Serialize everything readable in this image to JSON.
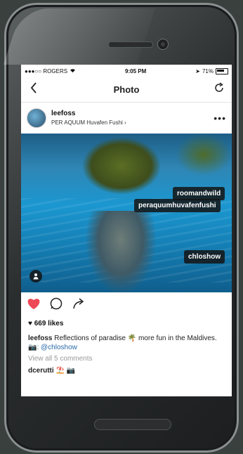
{
  "status_bar": {
    "carrier": "●●●○○ ROGERS",
    "time": "9:05 PM",
    "battery": "71%"
  },
  "nav": {
    "title": "Photo",
    "back_icon": "back-chevron-icon",
    "refresh_icon": "refresh-icon"
  },
  "post": {
    "username": "leefoss",
    "location": "PER AQUUM Huvafen Fushi",
    "more_label": "•••",
    "tags": [
      "roomandwild",
      "peraquumhuvafenfushi",
      "chloshow"
    ],
    "likes": "♥ 669 likes",
    "caption_user": "leefoss",
    "caption_text": "Reflections of paradise 🌴 more fun in the Maldives.",
    "caption_mention": ": @chloshow",
    "view_comments": "View all 5 comments",
    "comment_user": "dcerutti",
    "comment_text": "⛱️ 📷"
  },
  "colors": {
    "like": "#ed4956",
    "mention": "#2b6aa8"
  }
}
